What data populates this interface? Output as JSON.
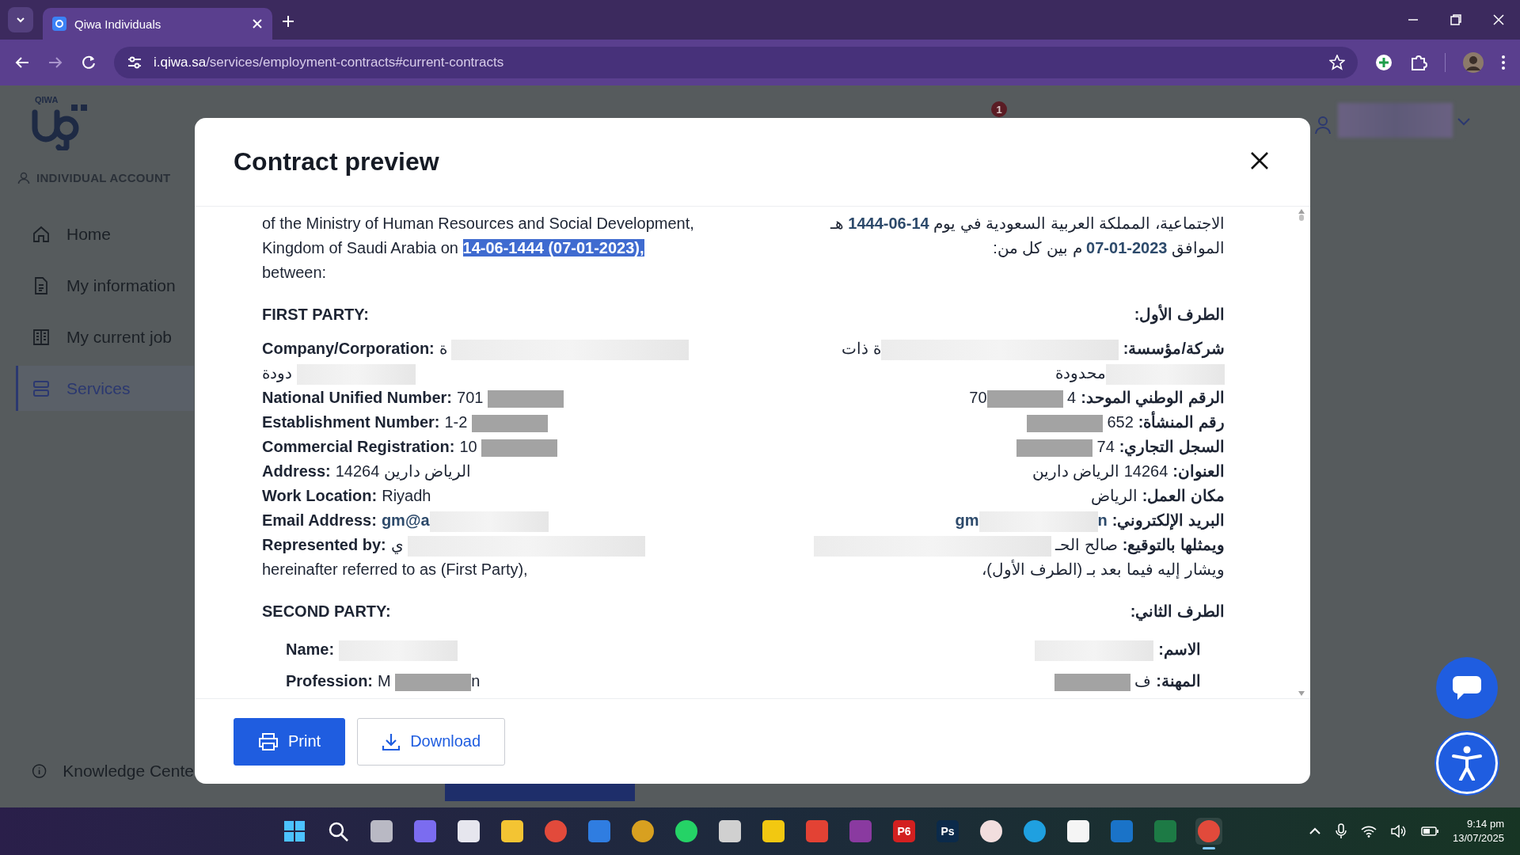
{
  "browser": {
    "tab_title": "Qiwa Individuals",
    "url_host": "i.qiwa.sa",
    "url_path": "/services/employment-contracts#current-contracts"
  },
  "sidebar": {
    "logo_text": "QIWA",
    "account_label": "INDIVIDUAL ACCOUNT",
    "items": [
      {
        "kind": "home",
        "label": "Home",
        "selected": false
      },
      {
        "kind": "document",
        "label": "My information",
        "selected": false
      },
      {
        "kind": "building",
        "label": "My current job",
        "selected": false
      },
      {
        "kind": "services",
        "label": "Services",
        "selected": true
      }
    ],
    "footer_item": {
      "label": "Knowledge Cente"
    }
  },
  "header": {
    "notification_count": "1"
  },
  "modal": {
    "title": "Contract preview",
    "sections": [
      {
        "left": [
          {
            "kind": "text",
            "parts": [
              {
                "kind": "text",
                "text": "of the Ministry of Human Resources and Social Development,"
              }
            ]
          },
          {
            "kind": "text",
            "text": "Kingdom of Saudi Arabia on ",
            "highlight": "14-06-1444 (07-01-2023),"
          },
          {
            "kind": "text",
            "parts": [
              {
                "kind": "text",
                "text": "between:"
              }
            ]
          }
        ],
        "right": [
          {
            "kind": "text",
            "parts": [
              {
                "kind": "text",
                "text": "الاجتماعية، المملكة العربية السعودية في يوم "
              },
              {
                "kind": "accent",
                "text": "14-06-1444"
              },
              {
                "kind": "text",
                "text": " هـ"
              }
            ]
          },
          {
            "kind": "text",
            "parts": [
              {
                "kind": "text",
                "text": "الموافق "
              },
              {
                "kind": "accent",
                "text": "2023-01-07"
              },
              {
                "kind": "text",
                "text": " م بين كل من:"
              }
            ]
          }
        ]
      },
      {
        "left": [
          {
            "kind": "heading",
            "text": "FIRST PARTY:"
          },
          {
            "kind": "field",
            "label": "Company/Corporation:",
            "parts": [
              {
                "kind": "text",
                "text": "ة"
              },
              {
                "kind": "wide-blur"
              }
            ]
          },
          {
            "kind": "field",
            "parts": [
              {
                "kind": "text",
                "text": "دودة"
              },
              {
                "kind": "blur"
              }
            ]
          },
          {
            "kind": "field",
            "label": "National Unified Number:",
            "parts": [
              {
                "kind": "text",
                "text": "701"
              },
              {
                "kind": "mask"
              }
            ]
          },
          {
            "kind": "field",
            "label": "Establishment Number:",
            "parts": [
              {
                "kind": "text",
                "text": "1-2"
              },
              {
                "kind": "mask"
              }
            ]
          },
          {
            "kind": "field",
            "label": "Commercial Registration:",
            "parts": [
              {
                "kind": "text",
                "text": "10"
              },
              {
                "kind": "mask"
              }
            ]
          },
          {
            "kind": "field",
            "label": "Address:",
            "parts": [
              {
                "kind": "text",
                "text": "14264 الرياض دارين"
              }
            ]
          },
          {
            "kind": "field",
            "label": "Work Location:",
            "parts": [
              {
                "kind": "text",
                "text": "Riyadh"
              }
            ]
          },
          {
            "kind": "field",
            "label": "Email Address:",
            "parts": [
              {
                "kind": "accent",
                "text": "gm@a"
              },
              {
                "kind": "blur"
              }
            ]
          },
          {
            "kind": "field",
            "label": "Represented by:",
            "parts": [
              {
                "kind": "text",
                "text": "ي"
              },
              {
                "kind": "wide-blur"
              }
            ]
          },
          {
            "kind": "text",
            "parts": [
              {
                "kind": "text",
                "text": "hereinafter referred to as (First Party),"
              }
            ]
          }
        ],
        "right": [
          {
            "kind": "heading",
            "text": "الطرف الأول:"
          },
          {
            "kind": "field",
            "label": "شركة/مؤسسة:",
            "parts": [
              {
                "kind": "wide-blur"
              },
              {
                "kind": "text",
                "text": "ة ذات"
              }
            ]
          },
          {
            "kind": "field",
            "parts": [
              {
                "kind": "blur"
              },
              {
                "kind": "text",
                "text": "محدودة"
              }
            ]
          },
          {
            "kind": "field",
            "label": "الرقم الوطني الموحد:",
            "parts": [
              {
                "kind": "text",
                "text": "4"
              },
              {
                "kind": "mask"
              },
              {
                "kind": "text",
                "text": "70"
              }
            ]
          },
          {
            "kind": "field",
            "label": "رقم المنشأة:",
            "parts": [
              {
                "kind": "text",
                "text": "652"
              },
              {
                "kind": "mask"
              }
            ]
          },
          {
            "kind": "field",
            "label": "السجل التجاري:",
            "parts": [
              {
                "kind": "text",
                "text": "74"
              },
              {
                "kind": "mask"
              }
            ]
          },
          {
            "kind": "field",
            "label": "العنوان:",
            "parts": [
              {
                "kind": "text",
                "text": "14264 الرياض دارين"
              }
            ]
          },
          {
            "kind": "field",
            "label": "مكان العمل:",
            "parts": [
              {
                "kind": "text",
                "text": "الرياض"
              }
            ]
          },
          {
            "kind": "field",
            "label": "البريد الإلكتروني:",
            "parts": [
              {
                "kind": "accent",
                "text": "n"
              },
              {
                "kind": "blur"
              },
              {
                "kind": "accent",
                "text": "gm"
              }
            ]
          },
          {
            "kind": "field",
            "label": "ويمثلها بالتوقيع:",
            "parts": [
              {
                "kind": "text",
                "text": "صالح الحـ"
              },
              {
                "kind": "wide-blur"
              }
            ]
          },
          {
            "kind": "text",
            "parts": [
              {
                "kind": "text",
                "text": "ويشار إليه فيما بعد بـ (الطرف الأول)،"
              }
            ]
          }
        ]
      },
      {
        "left": [
          {
            "kind": "heading",
            "text": "SECOND PARTY:"
          },
          {
            "kind": "subfield",
            "label": "Name:",
            "parts": [
              {
                "kind": "blur"
              }
            ]
          },
          {
            "kind": "subfield",
            "label": "Profession:",
            "value_start": "M",
            "redacted": true,
            "value_end": "n"
          }
        ],
        "right": [
          {
            "kind": "heading",
            "text": "الطرف الثاني:"
          },
          {
            "kind": "subfield",
            "label": "الاسم:",
            "parts": [
              {
                "kind": "blur"
              }
            ]
          },
          {
            "kind": "subfield",
            "label": "المهنة:",
            "parts": [
              {
                "kind": "text",
                "text": "ف"
              },
              {
                "kind": "mask"
              }
            ]
          }
        ]
      }
    ],
    "print_button": {
      "label": "Print"
    },
    "download_button": {
      "label": "Download"
    }
  },
  "taskbar": {
    "apps": [
      {
        "kind": "start",
        "selected": false
      },
      {
        "kind": "search",
        "selected": false
      },
      {
        "kind": "tile",
        "color": "#b9b9c4",
        "selected": false
      },
      {
        "kind": "tile",
        "color": "#7b6cf0",
        "selected": false
      },
      {
        "kind": "tile",
        "color": "#e6e6ee",
        "selected": false
      },
      {
        "kind": "tile",
        "color": "#f3c433",
        "selected": false
      },
      {
        "kind": "circle",
        "color": "#e24a3b",
        "selected": false
      },
      {
        "kind": "tile",
        "color": "#2f7de1",
        "selected": false
      },
      {
        "kind": "circle",
        "color": "#d8a020",
        "selected": false
      },
      {
        "kind": "circle",
        "color": "#25d366",
        "selected": false
      },
      {
        "kind": "tile",
        "color": "#d0d0d0",
        "selected": false
      },
      {
        "kind": "tile",
        "color": "#f2c811",
        "selected": false
      },
      {
        "kind": "tile",
        "color": "#e34234",
        "selected": false
      },
      {
        "kind": "tile",
        "color": "#8a3aa0",
        "selected": false
      },
      {
        "kind": "tile",
        "color": "#d32020",
        "label": "P6",
        "selected": false
      }
    ],
    "more_apps": [
      {
        "kind": "tile",
        "color": "#0b2a4a",
        "label": "Ps",
        "selected": false
      },
      {
        "kind": "circle",
        "color": "#f2dede",
        "selected": false
      },
      {
        "kind": "circle",
        "color": "#1fa0e0",
        "selected": false
      },
      {
        "kind": "tile",
        "color": "#f5f5f5",
        "selected": false
      },
      {
        "kind": "tile",
        "color": "#1a73c8",
        "selected": false
      },
      {
        "kind": "tile",
        "color": "#1d7a45",
        "selected": false
      },
      {
        "kind": "circle",
        "color": "#e24a3b",
        "selected": true
      }
    ],
    "time": "9:14 pm",
    "date": "13/07/2025"
  }
}
